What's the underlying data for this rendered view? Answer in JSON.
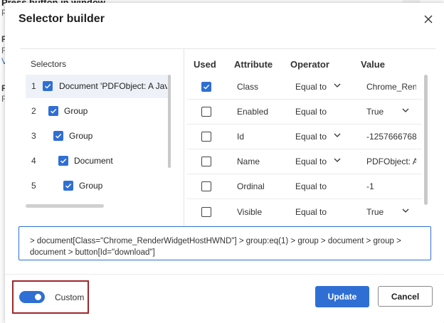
{
  "background": {
    "title": "Press button in window",
    "sub": "P",
    "marks": [
      "P",
      "F",
      "V",
      "F",
      "F"
    ]
  },
  "dialog": {
    "title": "Selector builder",
    "close_icon": "close-icon"
  },
  "selectors": {
    "heading": "Selectors",
    "items": [
      {
        "num": "1",
        "label": "Document 'PDFObject: A JavaScri",
        "checked": true
      },
      {
        "num": "2",
        "label": "Group",
        "checked": true
      },
      {
        "num": "3",
        "label": "Group",
        "checked": true
      },
      {
        "num": "4",
        "label": "Document",
        "checked": true
      },
      {
        "num": "5",
        "label": "Group",
        "checked": true
      }
    ]
  },
  "attributes": {
    "headers": {
      "used": "Used",
      "attribute": "Attribute",
      "operator": "Operator",
      "value": "Value"
    },
    "rows": [
      {
        "used": true,
        "attribute": "Class",
        "operator": "Equal to",
        "op_dropdown": true,
        "value": "Chrome_Rend",
        "value_dropdown": false
      },
      {
        "used": false,
        "attribute": "Enabled",
        "operator": "Equal to",
        "op_dropdown": false,
        "value": "True",
        "value_dropdown": true
      },
      {
        "used": false,
        "attribute": "Id",
        "operator": "Equal to",
        "op_dropdown": true,
        "value": "-1257666768",
        "value_dropdown": false
      },
      {
        "used": false,
        "attribute": "Name",
        "operator": "Equal to",
        "op_dropdown": true,
        "value": "PDFObject: A",
        "value_dropdown": false
      },
      {
        "used": false,
        "attribute": "Ordinal",
        "operator": "Equal to",
        "op_dropdown": false,
        "value": "-1",
        "value_dropdown": false
      },
      {
        "used": false,
        "attribute": "Visible",
        "operator": "Equal to",
        "op_dropdown": false,
        "value": "True",
        "value_dropdown": true
      }
    ]
  },
  "selector_expression": "> document[Class=\"Chrome_RenderWidgetHostHWND\"] > group:eq(1) > group > document > group > document > button[Id=\"download\"]",
  "footer": {
    "toggle_label": "Custom",
    "toggle_on": true,
    "update_label": "Update",
    "cancel_label": "Cancel"
  },
  "colors": {
    "accent": "#2f6fd4",
    "highlight": "#a0262a"
  }
}
